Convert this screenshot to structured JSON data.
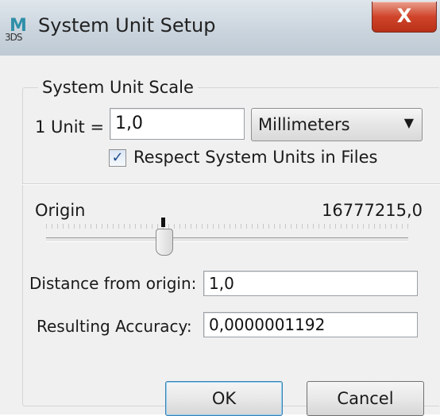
{
  "window": {
    "title": "System Unit Setup",
    "app_icon": {
      "letter": "M",
      "sub": "3DS"
    },
    "close_label": "X"
  },
  "group": {
    "label": "System Unit Scale",
    "unit_label": "1 Unit =",
    "unit_value": "1,0",
    "unit_select": "Millimeters",
    "respect_checked": true,
    "respect_label": "Respect System Units in Files"
  },
  "origin": {
    "label": "Origin",
    "value": "16777215,0",
    "slider_marker_icon": "slider-marker"
  },
  "distance": {
    "label": "Distance from origin:",
    "value": "1,0"
  },
  "accuracy": {
    "label": "Resulting Accuracy:",
    "value": "0,0000001192"
  },
  "buttons": {
    "ok": "OK",
    "cancel": "Cancel"
  },
  "colors": {
    "close_red": "#c8412a",
    "checkmark_blue": "#1f4e8c",
    "dialog_bg": "#f0f0f0"
  }
}
